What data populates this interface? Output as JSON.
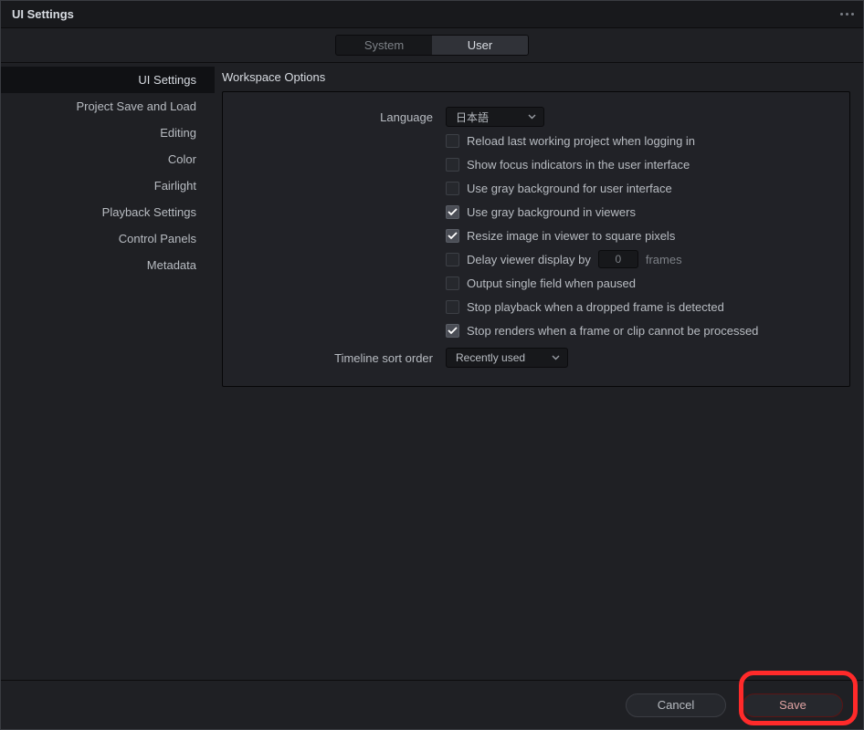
{
  "window": {
    "title": "UI Settings"
  },
  "tabs": {
    "system": "System",
    "user": "User",
    "active": "user"
  },
  "sidebar": {
    "items": [
      {
        "key": "ui-settings",
        "label": "UI Settings",
        "active": true
      },
      {
        "key": "project-save-load",
        "label": "Project Save and Load",
        "active": false
      },
      {
        "key": "editing",
        "label": "Editing",
        "active": false
      },
      {
        "key": "color",
        "label": "Color",
        "active": false
      },
      {
        "key": "fairlight",
        "label": "Fairlight",
        "active": false
      },
      {
        "key": "playback-settings",
        "label": "Playback Settings",
        "active": false
      },
      {
        "key": "control-panels",
        "label": "Control Panels",
        "active": false
      },
      {
        "key": "metadata",
        "label": "Metadata",
        "active": false
      }
    ]
  },
  "section": {
    "title": "Workspace Options"
  },
  "form": {
    "language_label": "Language",
    "language_value": "日本語",
    "checks": [
      {
        "key": "reload-last",
        "label": "Reload last working project when logging in",
        "checked": false
      },
      {
        "key": "focus-indicators",
        "label": "Show focus indicators in the user interface",
        "checked": false
      },
      {
        "key": "gray-ui",
        "label": "Use gray background for user interface",
        "checked": false
      },
      {
        "key": "gray-viewers",
        "label": "Use gray background in viewers",
        "checked": true
      },
      {
        "key": "square-pixels",
        "label": "Resize image in viewer to square pixels",
        "checked": true
      }
    ],
    "delay": {
      "label": "Delay viewer display by",
      "value": "0",
      "suffix": "frames",
      "checked": false
    },
    "checks2": [
      {
        "key": "single-field",
        "label": "Output single field when paused",
        "checked": false
      },
      {
        "key": "stop-dropped",
        "label": "Stop playback when a dropped frame is detected",
        "checked": false
      },
      {
        "key": "stop-renders",
        "label": "Stop renders when a frame or clip cannot be processed",
        "checked": true
      }
    ],
    "sort_label": "Timeline sort order",
    "sort_value": "Recently used"
  },
  "footer": {
    "cancel": "Cancel",
    "save": "Save"
  }
}
